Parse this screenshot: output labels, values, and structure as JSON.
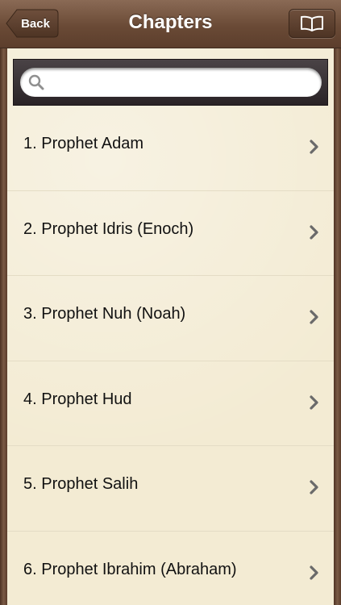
{
  "navbar": {
    "title": "Chapters",
    "back_label": "Back",
    "book_icon": "book-icon"
  },
  "search": {
    "value": "",
    "placeholder": ""
  },
  "chapters": [
    {
      "label": "1. Prophet Adam"
    },
    {
      "label": "2. Prophet Idris (Enoch)"
    },
    {
      "label": "3. Prophet Nuh (Noah)"
    },
    {
      "label": "4. Prophet Hud"
    },
    {
      "label": "5. Prophet Salih"
    },
    {
      "label": "6. Prophet Ibrahim (Abraham)"
    }
  ],
  "colors": {
    "navbar": "#6a4a36",
    "paper": "#f3ebd3",
    "search_bar": "#2a2326"
  }
}
